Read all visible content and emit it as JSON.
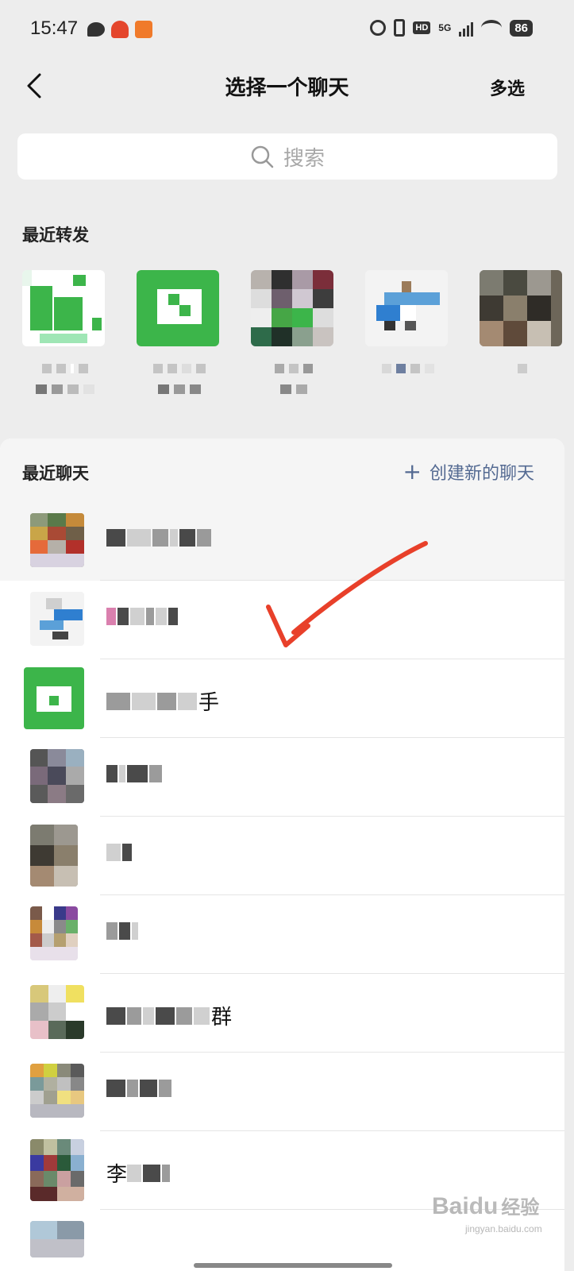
{
  "status_bar": {
    "time": "15:47",
    "network": "5G",
    "battery": "86",
    "hd_label": "HD",
    "icons": [
      "chat-bubble-icon",
      "robot-app-icon",
      "orange-app-icon",
      "alarm-icon",
      "vibrate-icon",
      "hd-icon",
      "signal-icon",
      "wifi-icon",
      "battery-icon"
    ]
  },
  "nav": {
    "title": "选择一个聊天",
    "multi_select": "多选",
    "back_icon": "chevron-left-icon"
  },
  "search": {
    "placeholder": "搜索",
    "icon": "search-icon"
  },
  "recent_forward": {
    "label": "最近转发",
    "items": [
      {
        "avatar": "green-logo-blurred"
      },
      {
        "avatar": "green-square-logo"
      },
      {
        "avatar": "pixelated-photo"
      },
      {
        "avatar": "blue-logo-blurred"
      },
      {
        "avatar": "pixelated-photo"
      }
    ]
  },
  "recent_chats": {
    "label": "最近聊天",
    "create_new": "创建新的聊天",
    "create_icon": "plus-icon",
    "rows": [
      {
        "name": ""
      },
      {
        "name": ""
      },
      {
        "name": "手"
      },
      {
        "name": ""
      },
      {
        "name": ""
      },
      {
        "name": ""
      },
      {
        "name": "群"
      },
      {
        "name": ""
      },
      {
        "name": "李"
      },
      {
        "name": ""
      }
    ]
  },
  "watermark": {
    "text": "Bai",
    "text2": "经验",
    "sub": "jingyan.baidu.com"
  },
  "colors": {
    "background": "#ededed",
    "accent_link": "#546a92",
    "wechat_green": "#3cb54a",
    "annotation_red": "#e8402a"
  }
}
